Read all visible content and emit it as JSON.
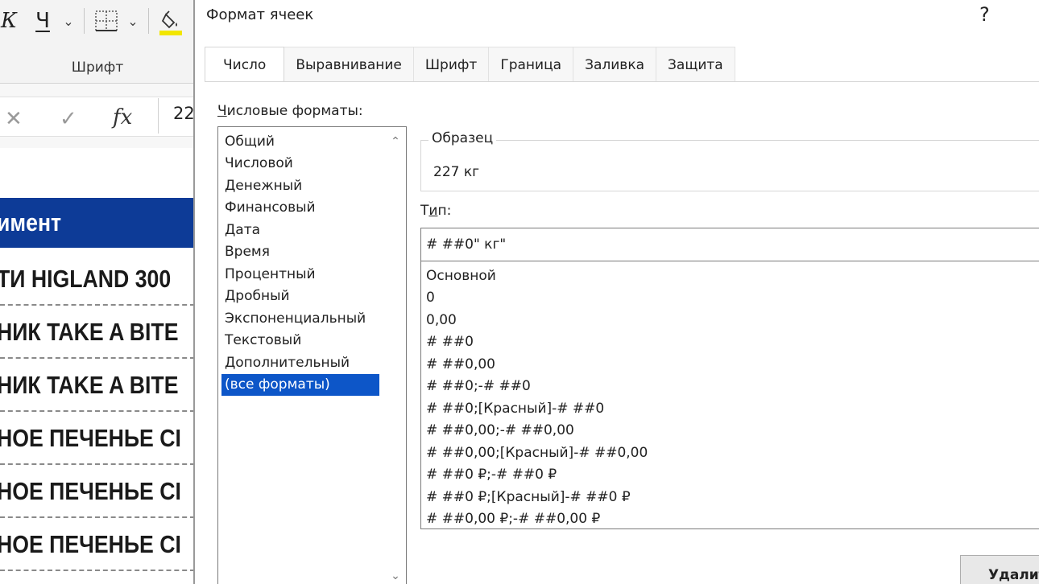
{
  "ribbon": {
    "italic_label": "К",
    "underline_label": "Ч",
    "group_label": "Шрифт",
    "icons": [
      "italic-icon",
      "underline-icon",
      "chevron-down-icon",
      "borders-icon",
      "fill-color-icon"
    ],
    "fill_color": "#f2e600"
  },
  "formula_bar": {
    "cancel_symbol": "✕",
    "enter_symbol": "✓",
    "fx_label": "fx",
    "value": "22"
  },
  "sheet": {
    "header": "имент",
    "header_color": "#0d3b97",
    "rows": [
      "ТИ HIGLAND 300",
      "НИК TAKE A BITE",
      "НИК TAKE A BITE",
      "НОЕ ПЕЧЕНЬЕ СI",
      "НОЕ ПЕЧЕНЬЕ СI",
      "НОЕ ПЕЧЕНЬЕ СI"
    ]
  },
  "dialog": {
    "title": "Формат ячеек",
    "help": "?",
    "tabs": [
      {
        "label": "Число",
        "active": true
      },
      {
        "label": "Выравнивание",
        "active": false
      },
      {
        "label": "Шрифт",
        "active": false
      },
      {
        "label": "Граница",
        "active": false
      },
      {
        "label": "Заливка",
        "active": false
      },
      {
        "label": "Защита",
        "active": false
      }
    ],
    "formats_label_first": "Ч",
    "formats_label_rest": "исловые форматы:",
    "formats": [
      "Общий",
      "Числовой",
      "Денежный",
      "Финансовый",
      "Дата",
      "Время",
      "Процентный",
      "Дробный",
      "Экспоненциальный",
      "Текстовый",
      "Дополнительный",
      "(все форматы)"
    ],
    "selected_format": "(все форматы)",
    "selection_color": "#0d56c8",
    "sample_label": "Образец",
    "sample_value": "227 кг",
    "type_label_pre": "Т",
    "type_label_under": "и",
    "type_label_post": "п:",
    "type_value": "# ##0\" кг\"",
    "type_list": [
      "Основной",
      "0",
      "0,00",
      "# ##0",
      "# ##0,00",
      "# ##0;-# ##0",
      "# ##0;[Красный]-# ##0",
      "# ##0,00;-# ##0,00",
      "# ##0,00;[Красный]-# ##0,00",
      "# ##0 ₽;-# ##0 ₽",
      "# ##0 ₽;[Красный]-# ##0 ₽",
      "# ##0,00 ₽;-# ##0,00 ₽"
    ],
    "delete_button": "Удалить"
  }
}
